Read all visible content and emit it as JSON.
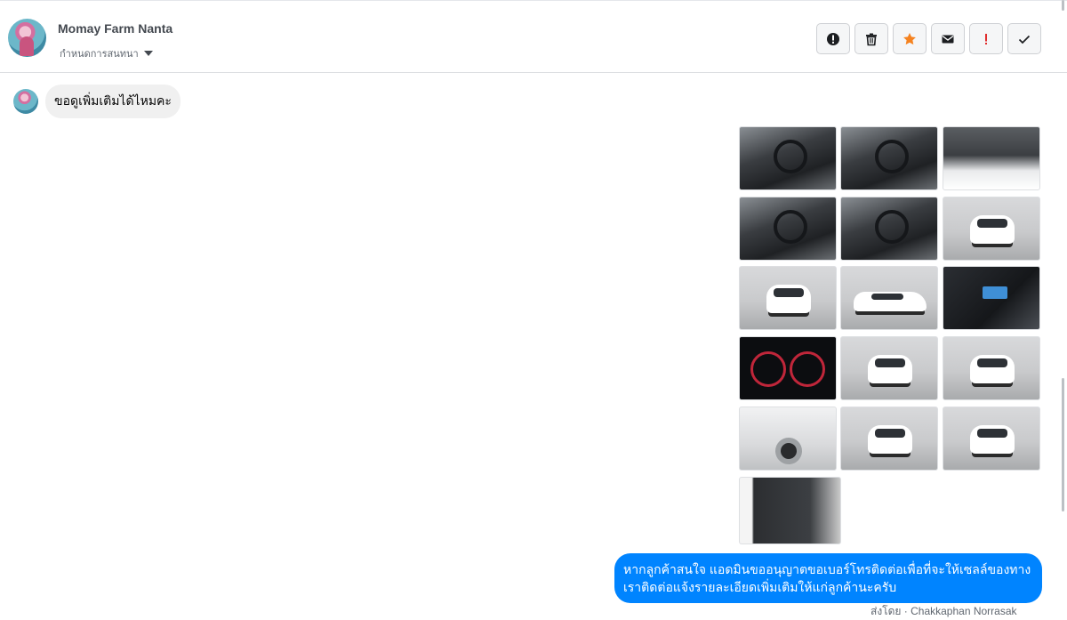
{
  "header": {
    "contact_name": "Momay Farm Nanta",
    "conversation_label": "กำหนดการสนทนา"
  },
  "actions": [
    {
      "name": "report-spam-button",
      "icon": "alert-circle-icon",
      "color": "#1c1e21"
    },
    {
      "name": "delete-button",
      "icon": "trash-icon",
      "color": "#1c1e21"
    },
    {
      "name": "star-button",
      "icon": "star-icon",
      "color": "#f5821f"
    },
    {
      "name": "mark-unread-button",
      "icon": "envelope-icon",
      "color": "#1c1e21"
    },
    {
      "name": "flag-important-button",
      "icon": "exclamation-icon",
      "color": "#e02d2d"
    },
    {
      "name": "mark-done-button",
      "icon": "check-icon",
      "color": "#1c1e21"
    }
  ],
  "messages": {
    "incoming": "ขอดูเพิ่มเติมได้ไหมคะ",
    "outgoing": "หากลูกค้าสนใจ แอดมินขออนุญาตขอเบอร์โทรติดต่อเพื่อที่จะให้เซลล์ของทางเราติดต่อแจ้งรายละเอียดเพิ่มเติมให้แก่ลูกค้านะครับ",
    "sent_by": "ส่งโดย · Chakkaphan Norrasak"
  },
  "photos": [
    "interior",
    "interior",
    "engine",
    "interior",
    "interior",
    "car",
    "car",
    "side",
    "console",
    "gauge",
    "car",
    "car",
    "closeup",
    "car",
    "car",
    "door"
  ],
  "colors": {
    "accent": "#0084ff",
    "star": "#f5821f",
    "alert": "#e02d2d"
  }
}
